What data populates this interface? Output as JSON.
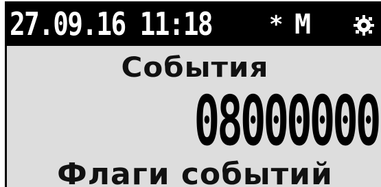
{
  "status_bar": {
    "datetime": "27.09.16 11:18",
    "star": "*",
    "mode": "M",
    "settings_icon": "gear-icon"
  },
  "main": {
    "title": "События",
    "counter": "08000000",
    "subtitle": "Флаги событий"
  },
  "colors": {
    "background": "#dddddd",
    "status_bar": "#000000",
    "foreground": "#000000"
  }
}
